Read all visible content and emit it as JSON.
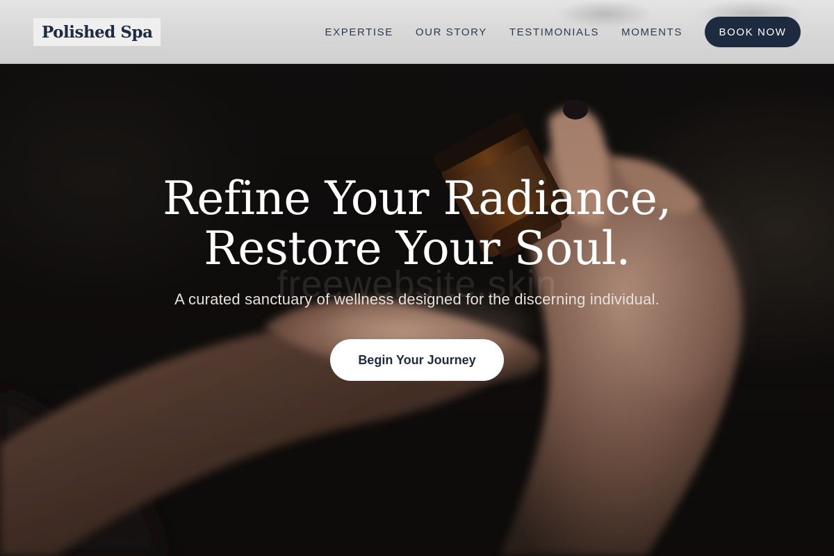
{
  "header": {
    "logo": "Polished Spa",
    "nav": [
      {
        "label": "EXPERTISE"
      },
      {
        "label": "OUR STORY"
      },
      {
        "label": "TESTIMONIALS"
      },
      {
        "label": "MOMENTS"
      }
    ],
    "book_label": "BOOK NOW"
  },
  "hero": {
    "title_line1": "Refine Your Radiance,",
    "title_line2": "Restore Your Soul.",
    "subtitle": "A curated sanctuary of wellness designed for the discerning individual.",
    "cta_label": "Begin Your Journey",
    "watermark": "freewebsite.skin"
  },
  "colors": {
    "brand_navy": "#1e2a3f",
    "header_bg": "#dcdcdc",
    "hero_text": "#ffffff"
  }
}
